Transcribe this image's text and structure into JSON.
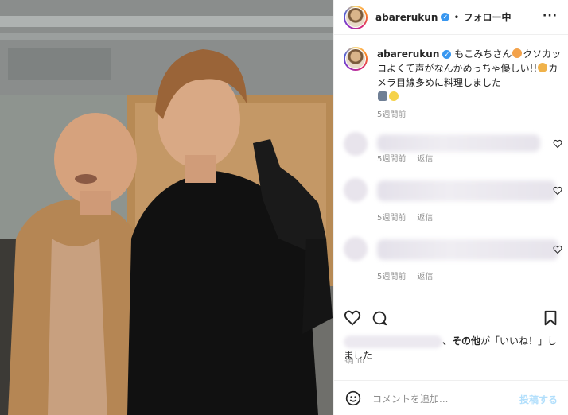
{
  "header": {
    "username": "abarerukun",
    "separator": "•",
    "follow_label": "フォロー中",
    "more_icon": "more-options-icon"
  },
  "caption": {
    "username": "abarerukun",
    "line1": "もこみちさん",
    "line1b": "クソカッコよくて声がなんかめっちゃ優しい!!",
    "line1c": "カメラ目線多めに料理しました",
    "time": "5週間前"
  },
  "comments": [
    {
      "time": "5週間前",
      "reply": "返信"
    },
    {
      "time": "5週間前",
      "reply": "返信"
    },
    {
      "time": "5週間前",
      "reply": "返信"
    }
  ],
  "likes": {
    "suffix_bold": "、その他",
    "suffix": "が「いいね！」しました"
  },
  "date": "3月 10",
  "add_comment": {
    "placeholder": "コメントを追加...",
    "post_label": "投稿する"
  },
  "colors": {
    "accent": "#3897f0",
    "post_disabled": "#b2dffc",
    "meta": "#8e8e8e"
  }
}
